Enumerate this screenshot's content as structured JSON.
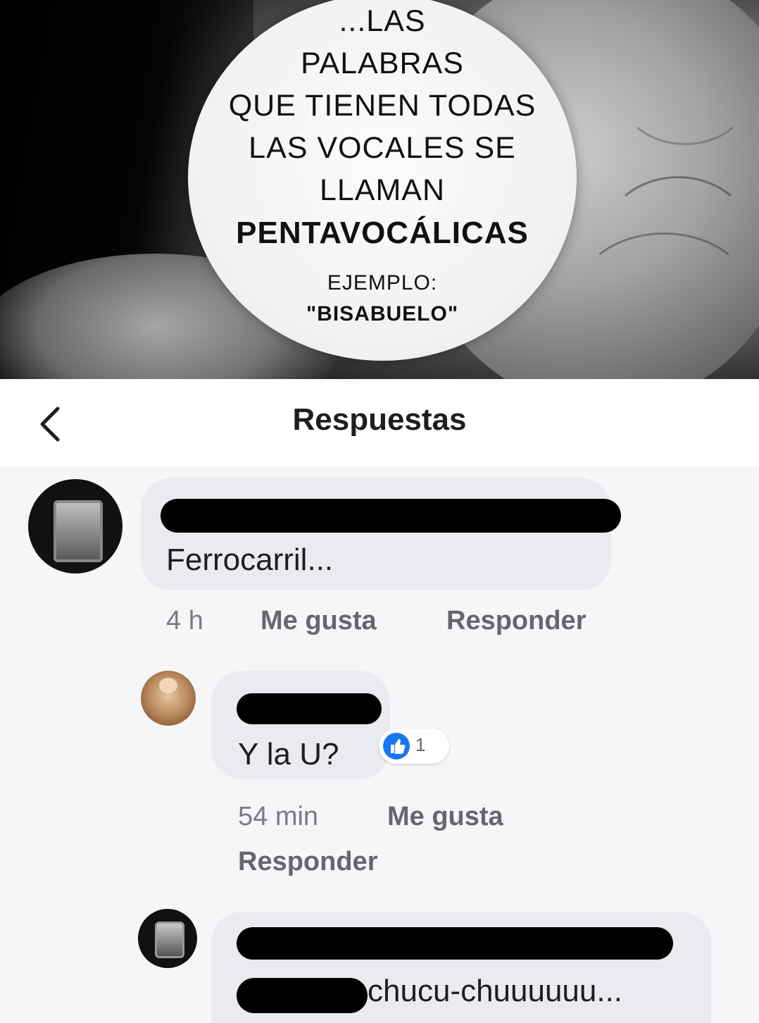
{
  "meme": {
    "lines": [
      "...LAS",
      "PALABRAS",
      "QUE TIENEN TODAS",
      "LAS VOCALES SE",
      "LLAMAN"
    ],
    "bold_line": "PENTAVOCÁLICAS",
    "example_label": "EJEMPLO:",
    "example_word": "\"BISABUELO\""
  },
  "header": {
    "title": "Respuestas",
    "back_icon": "chevron-left-icon"
  },
  "comments": [
    {
      "author": "",
      "text": "Ferrocarril...",
      "time": "4 h",
      "like_label": "Me gusta",
      "reply_label": "Responder"
    },
    {
      "author": "",
      "text": "Y la U?",
      "reaction_icon": "like-icon",
      "reaction_count": "1",
      "time": "54 min",
      "like_label": "Me gusta",
      "reply_label": "Responder"
    },
    {
      "author": "",
      "text": "chucu-chuuuuuu..."
    }
  ],
  "colors": {
    "accent": "#1877f2",
    "bubble_bg": "#e9ebee",
    "meta_text": "#65676b"
  }
}
